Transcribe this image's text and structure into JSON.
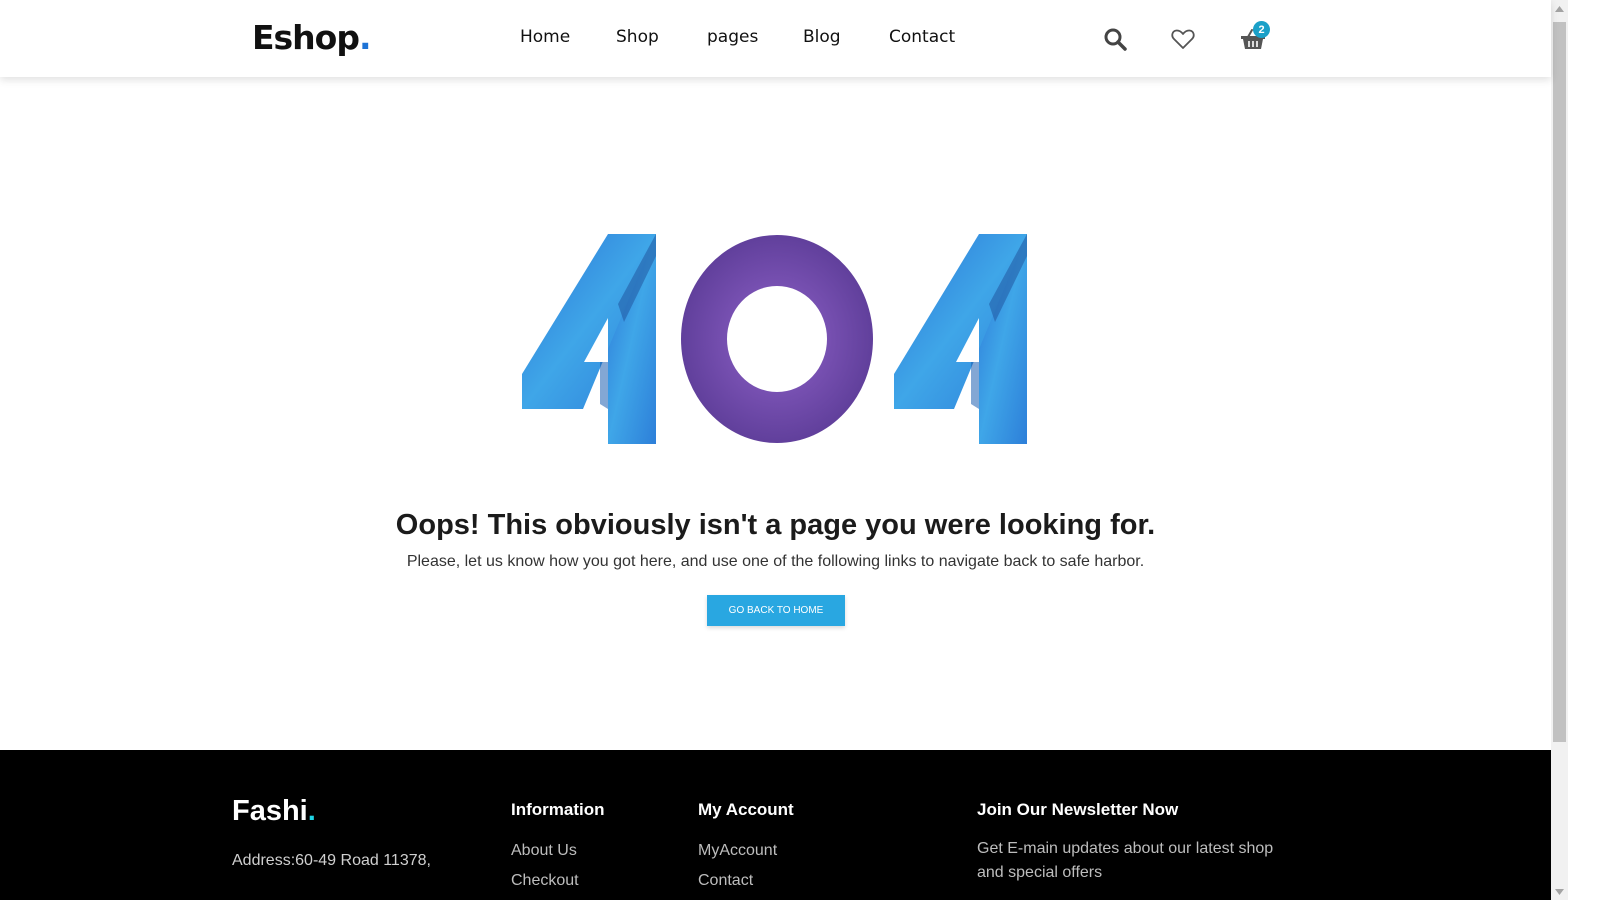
{
  "header": {
    "logo_text": "Eshop",
    "logo_dot": ".",
    "nav": [
      "Home",
      "Shop",
      "pages",
      "Blog",
      "Contact"
    ],
    "cart_count": "2",
    "icons": [
      "search-icon",
      "heart-icon",
      "basket-icon"
    ]
  },
  "main": {
    "error_code": "404",
    "headline": "Oops! This obviously isn't a page you were looking for.",
    "subtext": "Please, let us know how you got here, and use one of the following links to navigate back to safe harbor.",
    "button_label": "GO BACK TO HOME"
  },
  "footer": {
    "logo_text": "Fashi",
    "logo_dot": ".",
    "address": "Address:60-49 Road 11378,",
    "information_title": "Information",
    "information_links": [
      "About Us",
      "Checkout"
    ],
    "account_title": "My Account",
    "account_links": [
      "MyAccount",
      "Contact"
    ],
    "newsletter_title": "Join Our Newsletter Now",
    "newsletter_text": "Get E-main updates about our latest shop and special offers"
  },
  "colors": {
    "accent_blue": "#29a7e1",
    "digit_blue": "#2f86de",
    "zero_purple": "#6f4aa8",
    "badge": "#1aa0c8",
    "footer_bg": "#000000"
  }
}
